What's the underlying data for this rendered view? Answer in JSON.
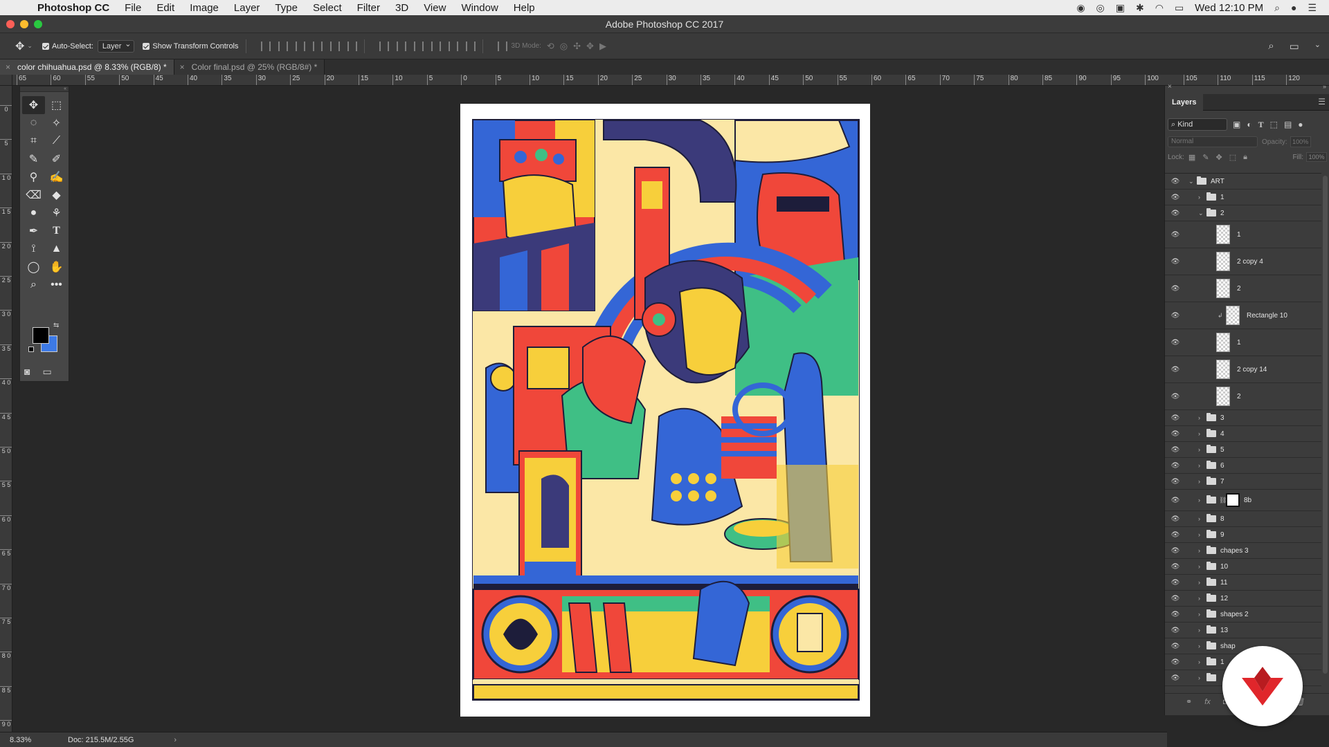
{
  "menubar": {
    "app_name": "Photoshop CC",
    "items": [
      "File",
      "Edit",
      "Image",
      "Layer",
      "Type",
      "Select",
      "Filter",
      "3D",
      "View",
      "Window",
      "Help"
    ],
    "clock": "Wed 12:10 PM"
  },
  "window": {
    "title": "Adobe Photoshop CC 2017"
  },
  "options_bar": {
    "auto_select_label": "Auto-Select:",
    "auto_select_value": "Layer",
    "show_transform_label": "Show Transform Controls",
    "mode_3d_label": "3D Mode:"
  },
  "tabs": [
    {
      "label": "color chihuahua.psd @ 8.33% (RGB/8) *",
      "active": true
    },
    {
      "label": "Color final.psd @ 25% (RGB/8#) *",
      "active": false
    }
  ],
  "ruler": {
    "top_labels": [
      "65",
      "60",
      "55",
      "50",
      "45",
      "40",
      "35",
      "30",
      "25",
      "20",
      "15",
      "10",
      "5",
      "0",
      "5",
      "10",
      "15",
      "20",
      "25",
      "30",
      "35",
      "40",
      "45",
      "50",
      "55",
      "60",
      "65",
      "70",
      "75",
      "80",
      "85",
      "90",
      "95",
      "100"
    ],
    "top_right_labels": [
      "105",
      "110",
      "115",
      "120"
    ],
    "left_labels": [
      "0",
      "5",
      "1 0",
      "1 5",
      "2 0",
      "2 5",
      "3 0",
      "3 5",
      "4 0",
      "4 5",
      "5 0",
      "5 5",
      "6 0",
      "6 5",
      "7 0",
      "7 5",
      "8 0",
      "8 5",
      "9 0"
    ]
  },
  "colors": {
    "foreground": "#000000",
    "background": "#3d7ae6",
    "art_red": "#f0473a",
    "art_yellow": "#f7cf3b",
    "art_blue": "#3466d6",
    "art_navy": "#3b3a7a",
    "art_green": "#3fbf85",
    "art_cream": "#fbe7a6"
  },
  "status": {
    "zoom": "8.33%",
    "doc_size": "Doc: 215.5M/2.55G"
  },
  "layers_panel": {
    "tab_label": "Layers",
    "filter_kind": "Kind",
    "blend_mode": "Normal",
    "opacity_label": "Opacity:",
    "opacity_value": "100%",
    "lock_label": "Lock:",
    "fill_label": "Fill:",
    "fill_value": "100%",
    "layers": [
      {
        "name": "ART",
        "kind": "group",
        "depth": 0,
        "expanded": true
      },
      {
        "name": "1",
        "kind": "group",
        "depth": 1,
        "expanded": false
      },
      {
        "name": "2",
        "kind": "group",
        "depth": 1,
        "expanded": true
      },
      {
        "name": "1",
        "kind": "layer",
        "depth": 2
      },
      {
        "name": "2 copy 4",
        "kind": "layer",
        "depth": 2
      },
      {
        "name": "2",
        "kind": "layer",
        "depth": 2
      },
      {
        "name": "Rectangle 10",
        "kind": "clipped",
        "depth": 2
      },
      {
        "name": "1",
        "kind": "layer",
        "depth": 2
      },
      {
        "name": "2 copy 14",
        "kind": "layer",
        "depth": 2
      },
      {
        "name": "2",
        "kind": "layer",
        "depth": 2
      },
      {
        "name": "3",
        "kind": "group",
        "depth": 1,
        "expanded": false
      },
      {
        "name": "4",
        "kind": "group",
        "depth": 1,
        "expanded": false
      },
      {
        "name": "5",
        "kind": "group",
        "depth": 1,
        "expanded": false
      },
      {
        "name": "6",
        "kind": "group",
        "depth": 1,
        "expanded": false
      },
      {
        "name": "7",
        "kind": "group",
        "depth": 1,
        "expanded": false
      },
      {
        "name": "8b",
        "kind": "masked-group",
        "depth": 1,
        "expanded": false
      },
      {
        "name": "8",
        "kind": "group",
        "depth": 1,
        "expanded": false
      },
      {
        "name": "9",
        "kind": "group",
        "depth": 1,
        "expanded": false
      },
      {
        "name": "chapes 3",
        "kind": "group",
        "depth": 1,
        "expanded": false
      },
      {
        "name": "10",
        "kind": "group",
        "depth": 1,
        "expanded": false
      },
      {
        "name": "11",
        "kind": "group",
        "depth": 1,
        "expanded": false
      },
      {
        "name": "12",
        "kind": "group",
        "depth": 1,
        "expanded": false
      },
      {
        "name": "shapes 2",
        "kind": "group",
        "depth": 1,
        "expanded": false
      },
      {
        "name": "13",
        "kind": "group",
        "depth": 1,
        "expanded": false
      },
      {
        "name": "shap",
        "kind": "group",
        "depth": 1,
        "expanded": false
      },
      {
        "name": "1",
        "kind": "group",
        "depth": 1,
        "expanded": false
      },
      {
        "name": "",
        "kind": "group",
        "depth": 1,
        "expanded": false
      }
    ]
  }
}
